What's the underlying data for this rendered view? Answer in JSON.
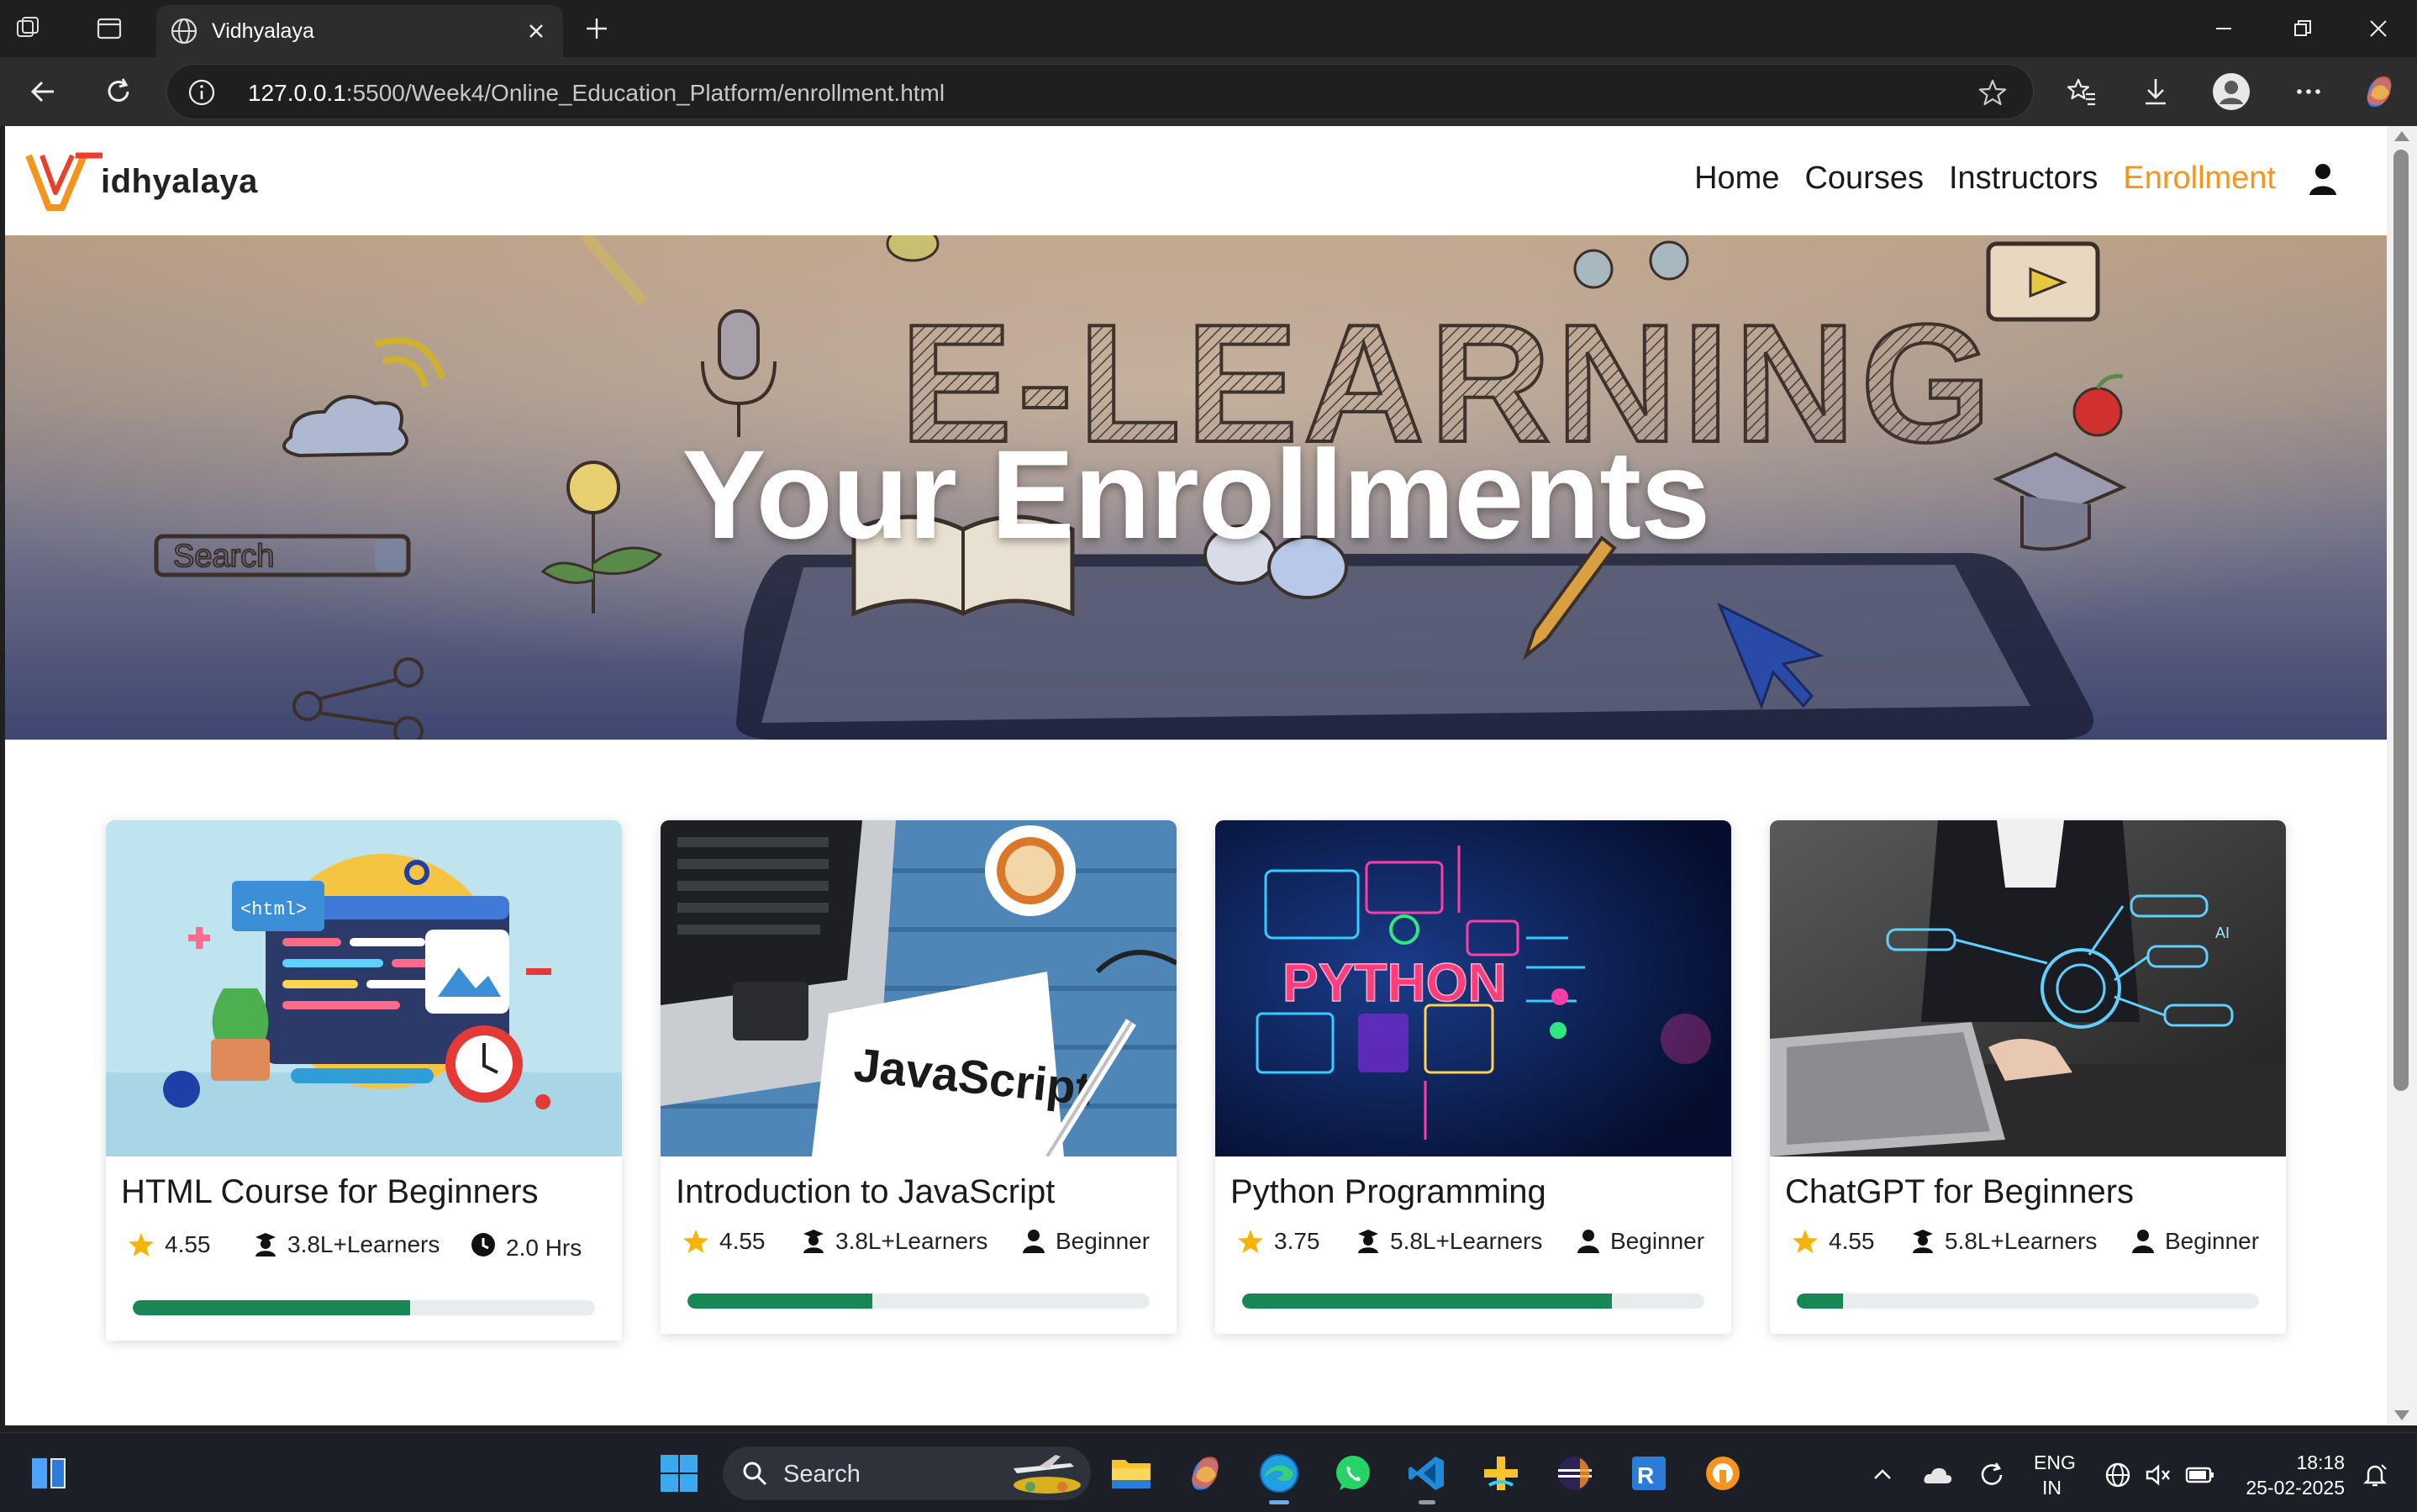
{
  "browser": {
    "tab_title": "Vidhyalaya",
    "url_host": "127.0.0.1",
    "url_rest": ":5500/Week4/Online_Education_Platform/enrollment.html"
  },
  "site": {
    "brand_text": "idhyalaya",
    "nav": {
      "home": "Home",
      "courses": "Courses",
      "instructors": "Instructors",
      "enrollment": "Enrollment"
    },
    "hero_title": "Your Enrollments",
    "hero_image_words": {
      "big": "E-LEARNING",
      "search": "Search"
    },
    "accent_color": "#f7941d",
    "progress_color": "#198754"
  },
  "courses": [
    {
      "title": "HTML Course for Beginners",
      "rating": "4.55",
      "learners": "3.8L+Learners",
      "extra": "2.0 Hrs",
      "extra_icon": "clock-icon",
      "progress": 0.6,
      "thumb_text": "<html>"
    },
    {
      "title": "Introduction to JavaScript",
      "rating": "4.55",
      "learners": "3.8L+Learners",
      "extra": "Beginner",
      "extra_icon": "user-icon",
      "progress": 0.4,
      "thumb_text": "JavaScript"
    },
    {
      "title": "Python Programming",
      "rating": "3.75",
      "learners": "5.8L+Learners",
      "extra": "Beginner",
      "extra_icon": "user-icon",
      "progress": 0.8,
      "thumb_text": "PYTHON"
    },
    {
      "title": "ChatGPT for Beginners",
      "rating": "4.55",
      "learners": "5.8L+Learners",
      "extra": "Beginner",
      "extra_icon": "user-icon",
      "progress": 0.1,
      "thumb_text": "AI"
    }
  ],
  "taskbar": {
    "search_placeholder": "Search",
    "lang_top": "ENG",
    "lang_bottom": "IN",
    "time": "18:18",
    "date": "25-02-2025"
  }
}
